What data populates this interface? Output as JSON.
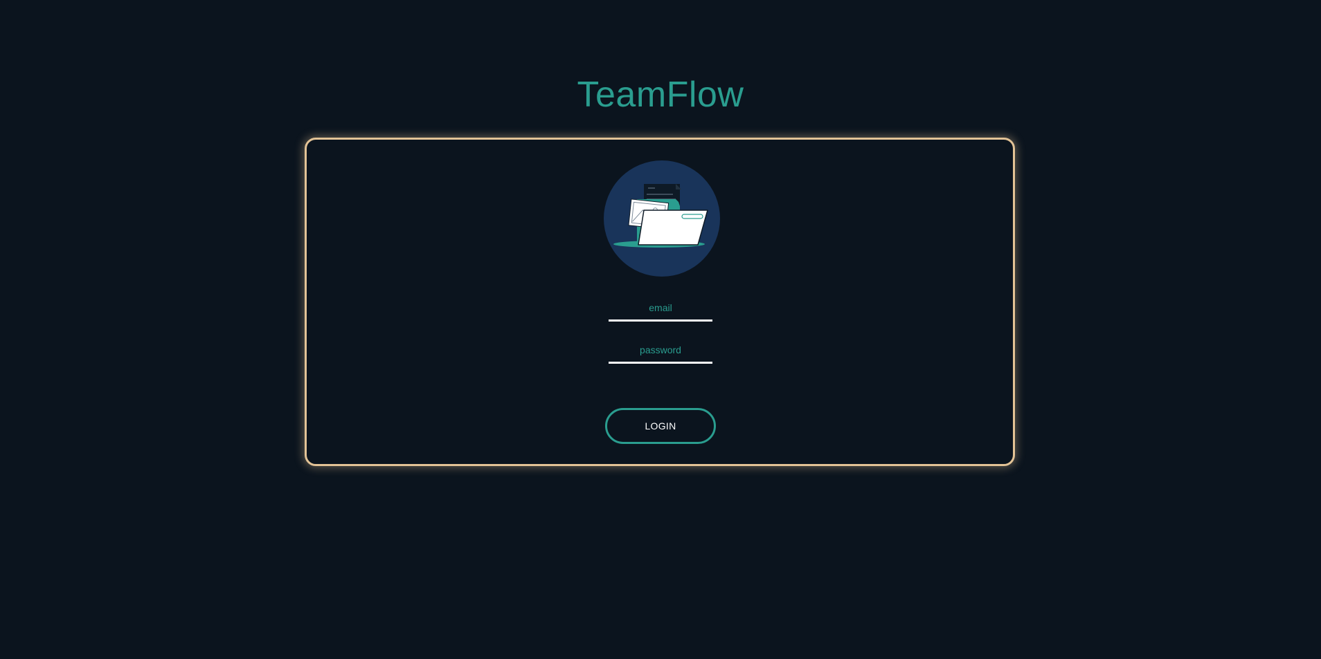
{
  "app": {
    "title": "TeamFlow"
  },
  "login_form": {
    "email_placeholder": "email",
    "email_value": "",
    "password_placeholder": "password",
    "password_value": "",
    "login_label": "LOGIN"
  },
  "illustration": {
    "icon": "folder-documents-icon"
  },
  "colors": {
    "background": "#0b141e",
    "accent": "#2a9d8f",
    "card_border": "#e3c396",
    "avatar_bg": "#19345a",
    "input_underline": "#ffffff"
  }
}
